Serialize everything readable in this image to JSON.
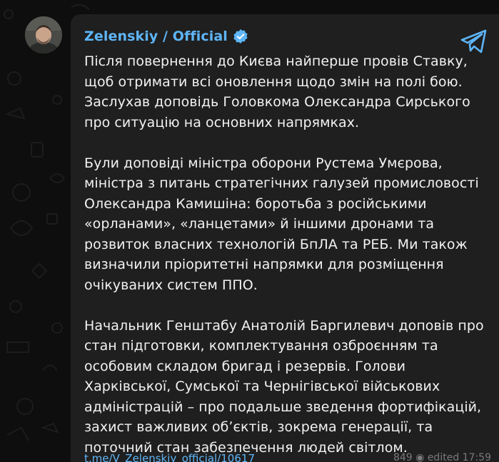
{
  "channel": {
    "name": "Zelenskiy / Official",
    "avatar_icon": "avatar-photo",
    "verified_icon": "verified-badge-icon",
    "share_icon": "telegram-share-icon"
  },
  "message": {
    "paragraphs": [
      "Після повернення до Києва найперше провів Ставку, щоб отримати всі оновлення щодо змін на полі бою. Заслухав доповідь Головкома Олександра Сирського про ситуацію на основних напрямках.",
      "Були доповіді міністра оборони Рустема Умєрова, міністра з питань стратегічних галузей промисловості Олександра Камишіна: боротьба з російськими «орланами», «ланцетами» й іншими дронами та розвиток власних технологій БпЛА та РЕБ. Ми також визначили пріоритетні напрямки для розміщення очікуваних систем ППО.",
      "Начальник Генштабу Анатолій Баргилевич доповів про стан підготовки, комплектування озброєнням та особовим складом бригад і резервів. Голови Харківської, Сумської та Чернігівської військових адміністрацій – про подальше зведення фортифікацій, захист важливих обʼєктів, зокрема генерації, та поточний стан забезпечення людей світлом."
    ],
    "footer_link": "t.me/V_Zelenskiy_official/10617",
    "footer_meta": "849 ◉ edited 17:59"
  },
  "colors": {
    "background": "#0e0e0e",
    "bubble": "#1f1f1f",
    "accent": "#5eb5f7",
    "text": "#f2f2f2"
  }
}
